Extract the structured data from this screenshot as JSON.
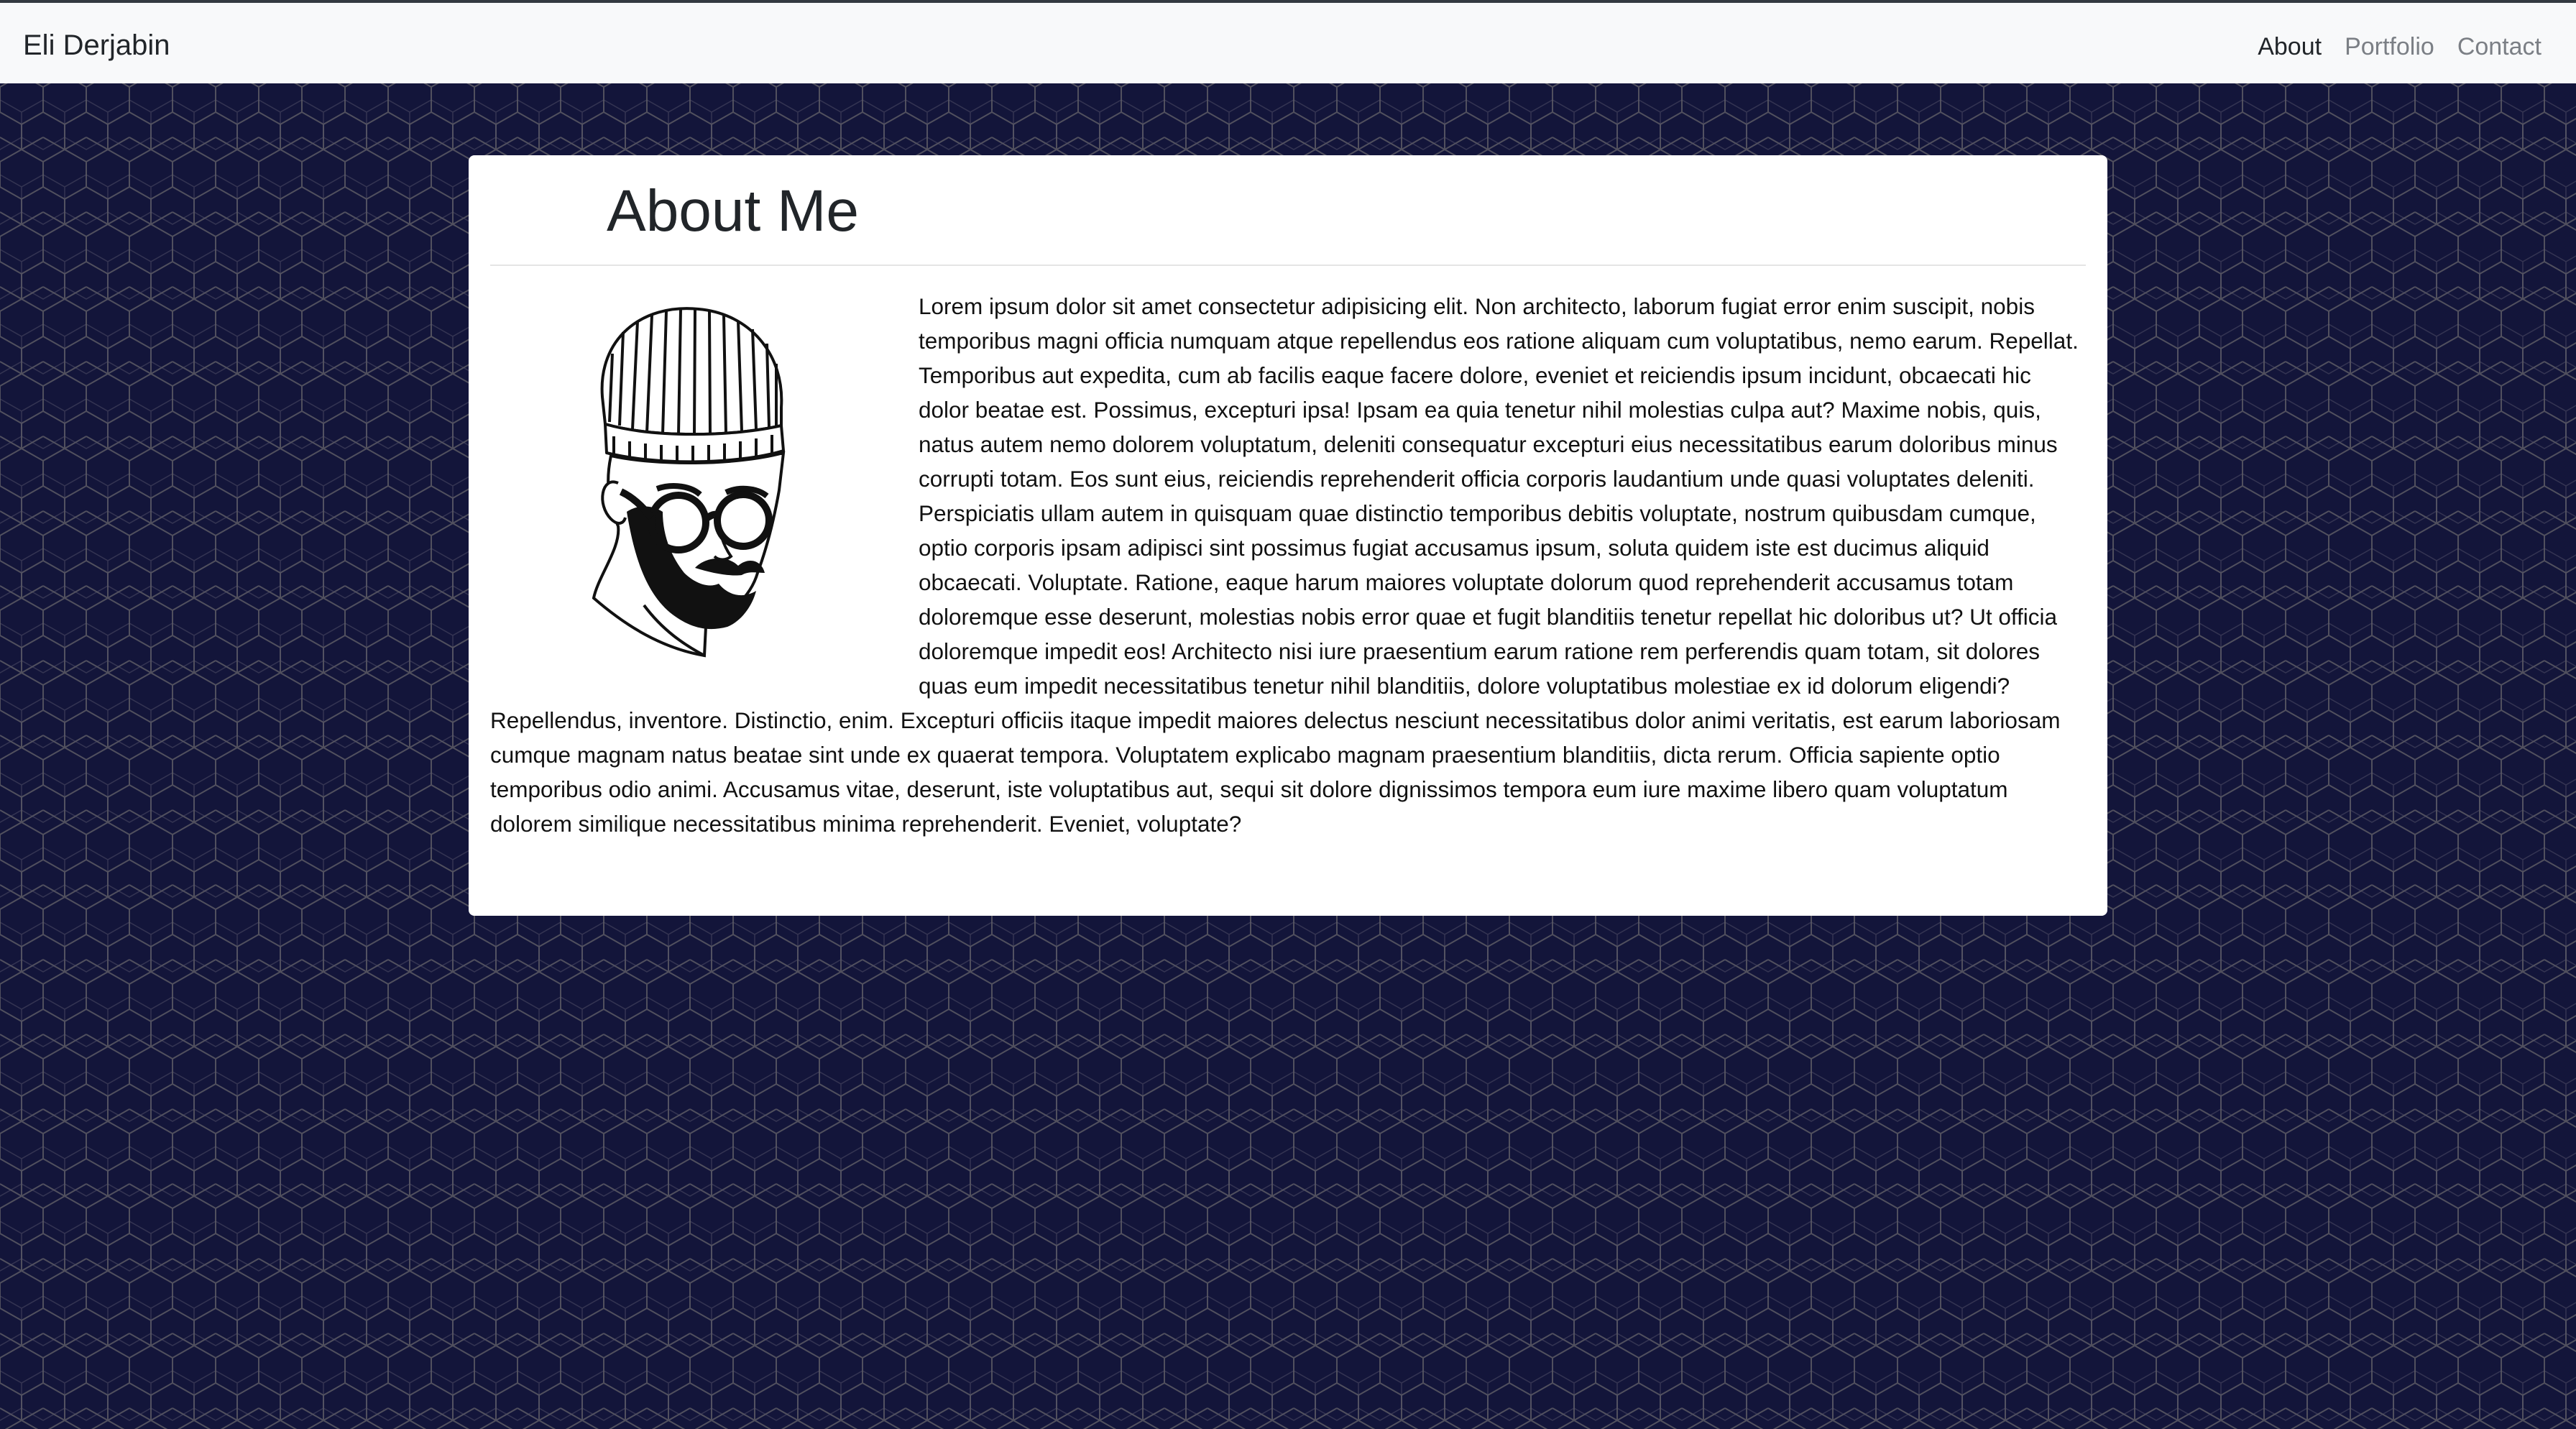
{
  "navbar": {
    "brand": "Eli Derjabin",
    "links": [
      {
        "label": "About",
        "active": true
      },
      {
        "label": "Portfolio",
        "active": false
      },
      {
        "label": "Contact",
        "active": false
      }
    ]
  },
  "about": {
    "title": "About Me",
    "body": "Lorem ipsum dolor sit amet consectetur adipisicing elit. Non architecto, laborum fugiat error enim suscipit, nobis temporibus magni officia numquam atque repellendus eos ratione aliquam cum voluptatibus, nemo earum. Repellat. Temporibus aut expedita, cum ab facilis eaque facere dolore, eveniet et reiciendis ipsum incidunt, obcaecati hic dolor beatae est. Possimus, excepturi ipsa! Ipsam ea quia tenetur nihil molestias culpa aut? Maxime nobis, quis, natus autem nemo dolorem voluptatum, deleniti consequatur excepturi eius necessitatibus earum doloribus minus corrupti totam. Eos sunt eius, reiciendis reprehenderit officia corporis laudantium unde quasi voluptates deleniti. Perspiciatis ullam autem in quisquam quae distinctio temporibus debitis voluptate, nostrum quibusdam cumque, optio corporis ipsam adipisci sint possimus fugiat accusamus ipsum, soluta quidem iste est ducimus aliquid obcaecati. Voluptate. Ratione, eaque harum maiores voluptate dolorum quod reprehenderit accusamus totam doloremque esse deserunt, molestias nobis error quae et fugit blanditiis tenetur repellat hic doloribus ut? Ut officia doloremque impedit eos! Architecto nisi iure praesentium earum ratione rem perferendis quam totam, sit dolores quas eum impedit necessitatibus tenetur nihil blanditiis, dolore voluptatibus molestiae ex id dolorum eligendi? Repellendus, inventore. Distinctio, enim. Excepturi officiis itaque impedit maiores delectus nesciunt necessitatibus dolor animi veritatis, est earum laboriosam cumque magnam natus beatae sint unde ex quaerat tempora. Voluptatem explicabo magnam praesentium blanditiis, dicta rerum. Officia sapiente optio temporibus odio animi. Accusamus vitae, deserunt, iste voluptatibus aut, sequi sit dolore dignissimos tempora eum iure maxime libero quam voluptatum dolorem similique necessitatibus minima reprehenderit. Eveniet, voluptate?",
    "portrait_icon": "bearded-man-beanie-glasses-illustration"
  },
  "colors": {
    "navbar_bg": "#f8f9fa",
    "page_bg": "#13153a",
    "pattern_line": "#6b6a6e",
    "card_bg": "#ffffff",
    "text": "#212529",
    "nav_inactive": "#7b7f85"
  }
}
